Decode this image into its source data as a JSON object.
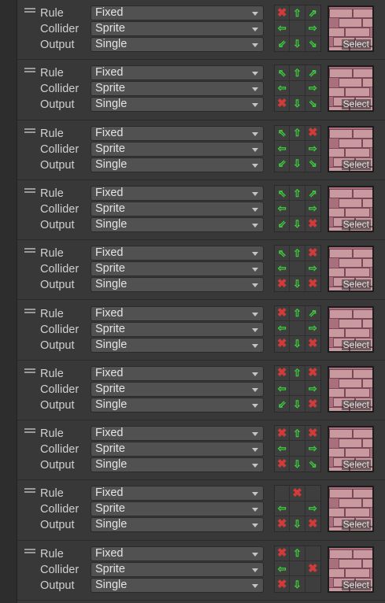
{
  "labels": {
    "rule": "Rule",
    "collider": "Collider",
    "output": "Output",
    "select": "Select"
  },
  "colors": {
    "neighbor_this": "#3bd13b",
    "neighbor_not_this": "#d33a3a"
  },
  "rules": [
    {
      "rule": "Fixed",
      "collider": "Sprite",
      "output": "Single",
      "grid": [
        "x",
        "up",
        "ur",
        "left",
        "",
        "right",
        "dl",
        "down",
        "dr"
      ]
    },
    {
      "rule": "Fixed",
      "collider": "Sprite",
      "output": "Single",
      "grid": [
        "ul",
        "up",
        "ur",
        "left",
        "",
        "right",
        "x",
        "down",
        "dr"
      ]
    },
    {
      "rule": "Fixed",
      "collider": "Sprite",
      "output": "Single",
      "grid": [
        "ul",
        "up",
        "x",
        "left",
        "",
        "right",
        "dl",
        "down",
        "dr"
      ]
    },
    {
      "rule": "Fixed",
      "collider": "Sprite",
      "output": "Single",
      "grid": [
        "ul",
        "up",
        "ur",
        "left",
        "",
        "right",
        "dl",
        "down",
        "x"
      ]
    },
    {
      "rule": "Fixed",
      "collider": "Sprite",
      "output": "Single",
      "grid": [
        "ul",
        "up",
        "x",
        "left",
        "",
        "right",
        "x",
        "down",
        "x"
      ]
    },
    {
      "rule": "Fixed",
      "collider": "Sprite",
      "output": "Single",
      "grid": [
        "x",
        "up",
        "ur",
        "left",
        "",
        "right",
        "x",
        "down",
        "x"
      ]
    },
    {
      "rule": "Fixed",
      "collider": "Sprite",
      "output": "Single",
      "grid": [
        "x",
        "up",
        "x",
        "left",
        "",
        "right",
        "dl",
        "down",
        "x"
      ]
    },
    {
      "rule": "Fixed",
      "collider": "Sprite",
      "output": "Single",
      "grid": [
        "x",
        "up",
        "x",
        "left",
        "",
        "right",
        "x",
        "down",
        "dr"
      ]
    },
    {
      "rule": "Fixed",
      "collider": "Sprite",
      "output": "Single",
      "grid": [
        "",
        "x",
        "",
        "left",
        "",
        "right",
        "x",
        "down",
        "x"
      ]
    },
    {
      "rule": "Fixed",
      "collider": "Sprite",
      "output": "Single",
      "grid": [
        "x",
        "up",
        "",
        "left",
        "",
        "x",
        "x",
        "down",
        ""
      ]
    }
  ]
}
